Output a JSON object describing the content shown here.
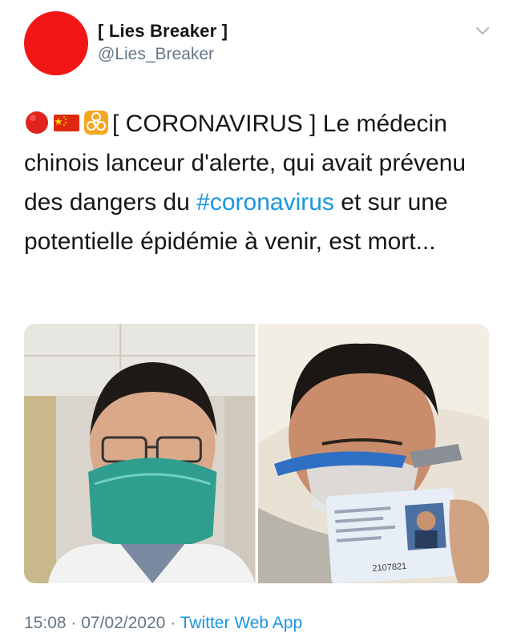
{
  "author": {
    "name": "[ Lies Breaker ]",
    "handle": "@Lies_Breaker",
    "avatar_color": "#f21616"
  },
  "tweet": {
    "emojis": [
      "red-circle",
      "china-flag",
      "biohazard"
    ],
    "text_before_hashtag": "[ CORONAVIRUS ] Le médecin chinois lanceur d'alerte, qui avait prévenu des dangers du ",
    "hashtag": "#coronavirus",
    "text_after_hashtag": " et sur une potentielle épidémie à venir, est mort..."
  },
  "media": {
    "photo_1": "selfie-doctor-mask",
    "photo_2": "patient-oxygen-mask-id-card",
    "id_card_number": "2107821"
  },
  "meta": {
    "time": "15:08",
    "separator_1": " · ",
    "date": "07/02/2020",
    "separator_2": " · ",
    "source": "Twitter Web App"
  },
  "colors": {
    "text": "#14171a",
    "secondary": "#657786",
    "link": "#1b95e0"
  }
}
